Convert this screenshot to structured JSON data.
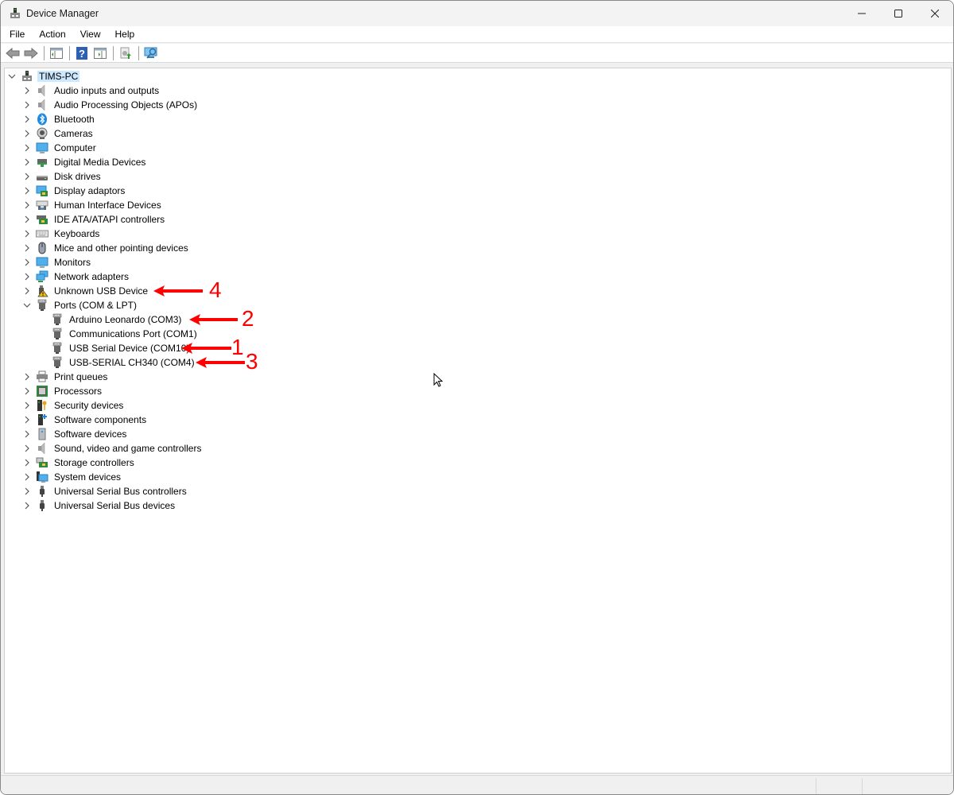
{
  "window": {
    "title": "Device Manager",
    "controls": {
      "minimize": "—",
      "maximize": "☐",
      "close": "✕"
    }
  },
  "menu": [
    {
      "label": "File"
    },
    {
      "label": "Action"
    },
    {
      "label": "View"
    },
    {
      "label": "Help"
    }
  ],
  "toolbar": [
    {
      "name": "back-button",
      "icon": "back-arrow-icon"
    },
    {
      "name": "forward-button",
      "icon": "forward-arrow-icon"
    },
    {
      "name": "show-hide-console-tree-button",
      "icon": "console-tree-icon"
    },
    {
      "name": "help-button",
      "icon": "help-icon",
      "glyph": "?"
    },
    {
      "name": "show-action-pane-button",
      "icon": "action-pane-icon"
    },
    {
      "name": "update-driver-button",
      "icon": "update-driver-icon"
    },
    {
      "name": "scan-hardware-button",
      "icon": "scan-hardware-icon"
    }
  ],
  "tree": {
    "root": {
      "label": "TIMS-PC",
      "expanded": true,
      "selected": true,
      "icon": "computer-tower-icon"
    },
    "items": [
      {
        "label": "Audio inputs and outputs",
        "icon": "speaker-icon",
        "expanded": false
      },
      {
        "label": "Audio Processing Objects (APOs)",
        "icon": "speaker-icon",
        "expanded": false
      },
      {
        "label": "Bluetooth",
        "icon": "bluetooth-icon",
        "expanded": false
      },
      {
        "label": "Cameras",
        "icon": "webcam-icon",
        "expanded": false
      },
      {
        "label": "Computer",
        "icon": "monitor-icon",
        "expanded": false
      },
      {
        "label": "Digital Media Devices",
        "icon": "media-device-icon",
        "expanded": false
      },
      {
        "label": "Disk drives",
        "icon": "disk-drive-icon",
        "expanded": false
      },
      {
        "label": "Display adaptors",
        "icon": "display-adapter-icon",
        "expanded": false
      },
      {
        "label": "Human Interface Devices",
        "icon": "hid-icon",
        "expanded": false
      },
      {
        "label": "IDE ATA/ATAPI controllers",
        "icon": "ide-controller-icon",
        "expanded": false
      },
      {
        "label": "Keyboards",
        "icon": "keyboard-icon",
        "expanded": false
      },
      {
        "label": "Mice and other pointing devices",
        "icon": "mouse-icon",
        "expanded": false
      },
      {
        "label": "Monitors",
        "icon": "monitor-icon",
        "expanded": false
      },
      {
        "label": "Network adapters",
        "icon": "network-icon",
        "expanded": false
      },
      {
        "label": "Unknown USB Device",
        "icon": "usb-warning-icon",
        "expanded": false
      },
      {
        "label": "Ports (COM & LPT)",
        "icon": "port-icon",
        "expanded": true,
        "children": [
          {
            "label": "Arduino Leonardo (COM3)",
            "icon": "port-icon"
          },
          {
            "label": "Communications Port (COM1)",
            "icon": "port-icon"
          },
          {
            "label": "USB Serial Device (COM10)",
            "icon": "port-icon"
          },
          {
            "label": "USB-SERIAL CH340 (COM4)",
            "icon": "port-icon"
          }
        ]
      },
      {
        "label": "Print queues",
        "icon": "printer-icon",
        "expanded": false
      },
      {
        "label": "Processors",
        "icon": "processor-icon",
        "expanded": false
      },
      {
        "label": "Security devices",
        "icon": "security-device-icon",
        "expanded": false
      },
      {
        "label": "Software components",
        "icon": "software-component-icon",
        "expanded": false
      },
      {
        "label": "Software devices",
        "icon": "software-device-icon",
        "expanded": false
      },
      {
        "label": "Sound, video and game controllers",
        "icon": "speaker-icon",
        "expanded": false
      },
      {
        "label": "Storage controllers",
        "icon": "storage-controller-icon",
        "expanded": false
      },
      {
        "label": "System devices",
        "icon": "system-devices-icon",
        "expanded": false
      },
      {
        "label": "Universal Serial Bus controllers",
        "icon": "usb-icon",
        "expanded": false
      },
      {
        "label": "Universal Serial Bus devices",
        "icon": "usb-icon",
        "expanded": false
      }
    ]
  },
  "annotations": [
    {
      "number": "4",
      "target": "Unknown USB Device",
      "color": "#ff0000"
    },
    {
      "number": "2",
      "target": "Arduino Leonardo (COM3)",
      "color": "#ff0000"
    },
    {
      "number": "1",
      "target": "USB Serial Device (COM10)",
      "color": "#ff0000"
    },
    {
      "number": "3",
      "target": "USB-SERIAL CH340 (COM4)",
      "color": "#ff0000"
    }
  ],
  "colors": {
    "selection": "#cce8ff",
    "annotation": "#ff0000"
  }
}
